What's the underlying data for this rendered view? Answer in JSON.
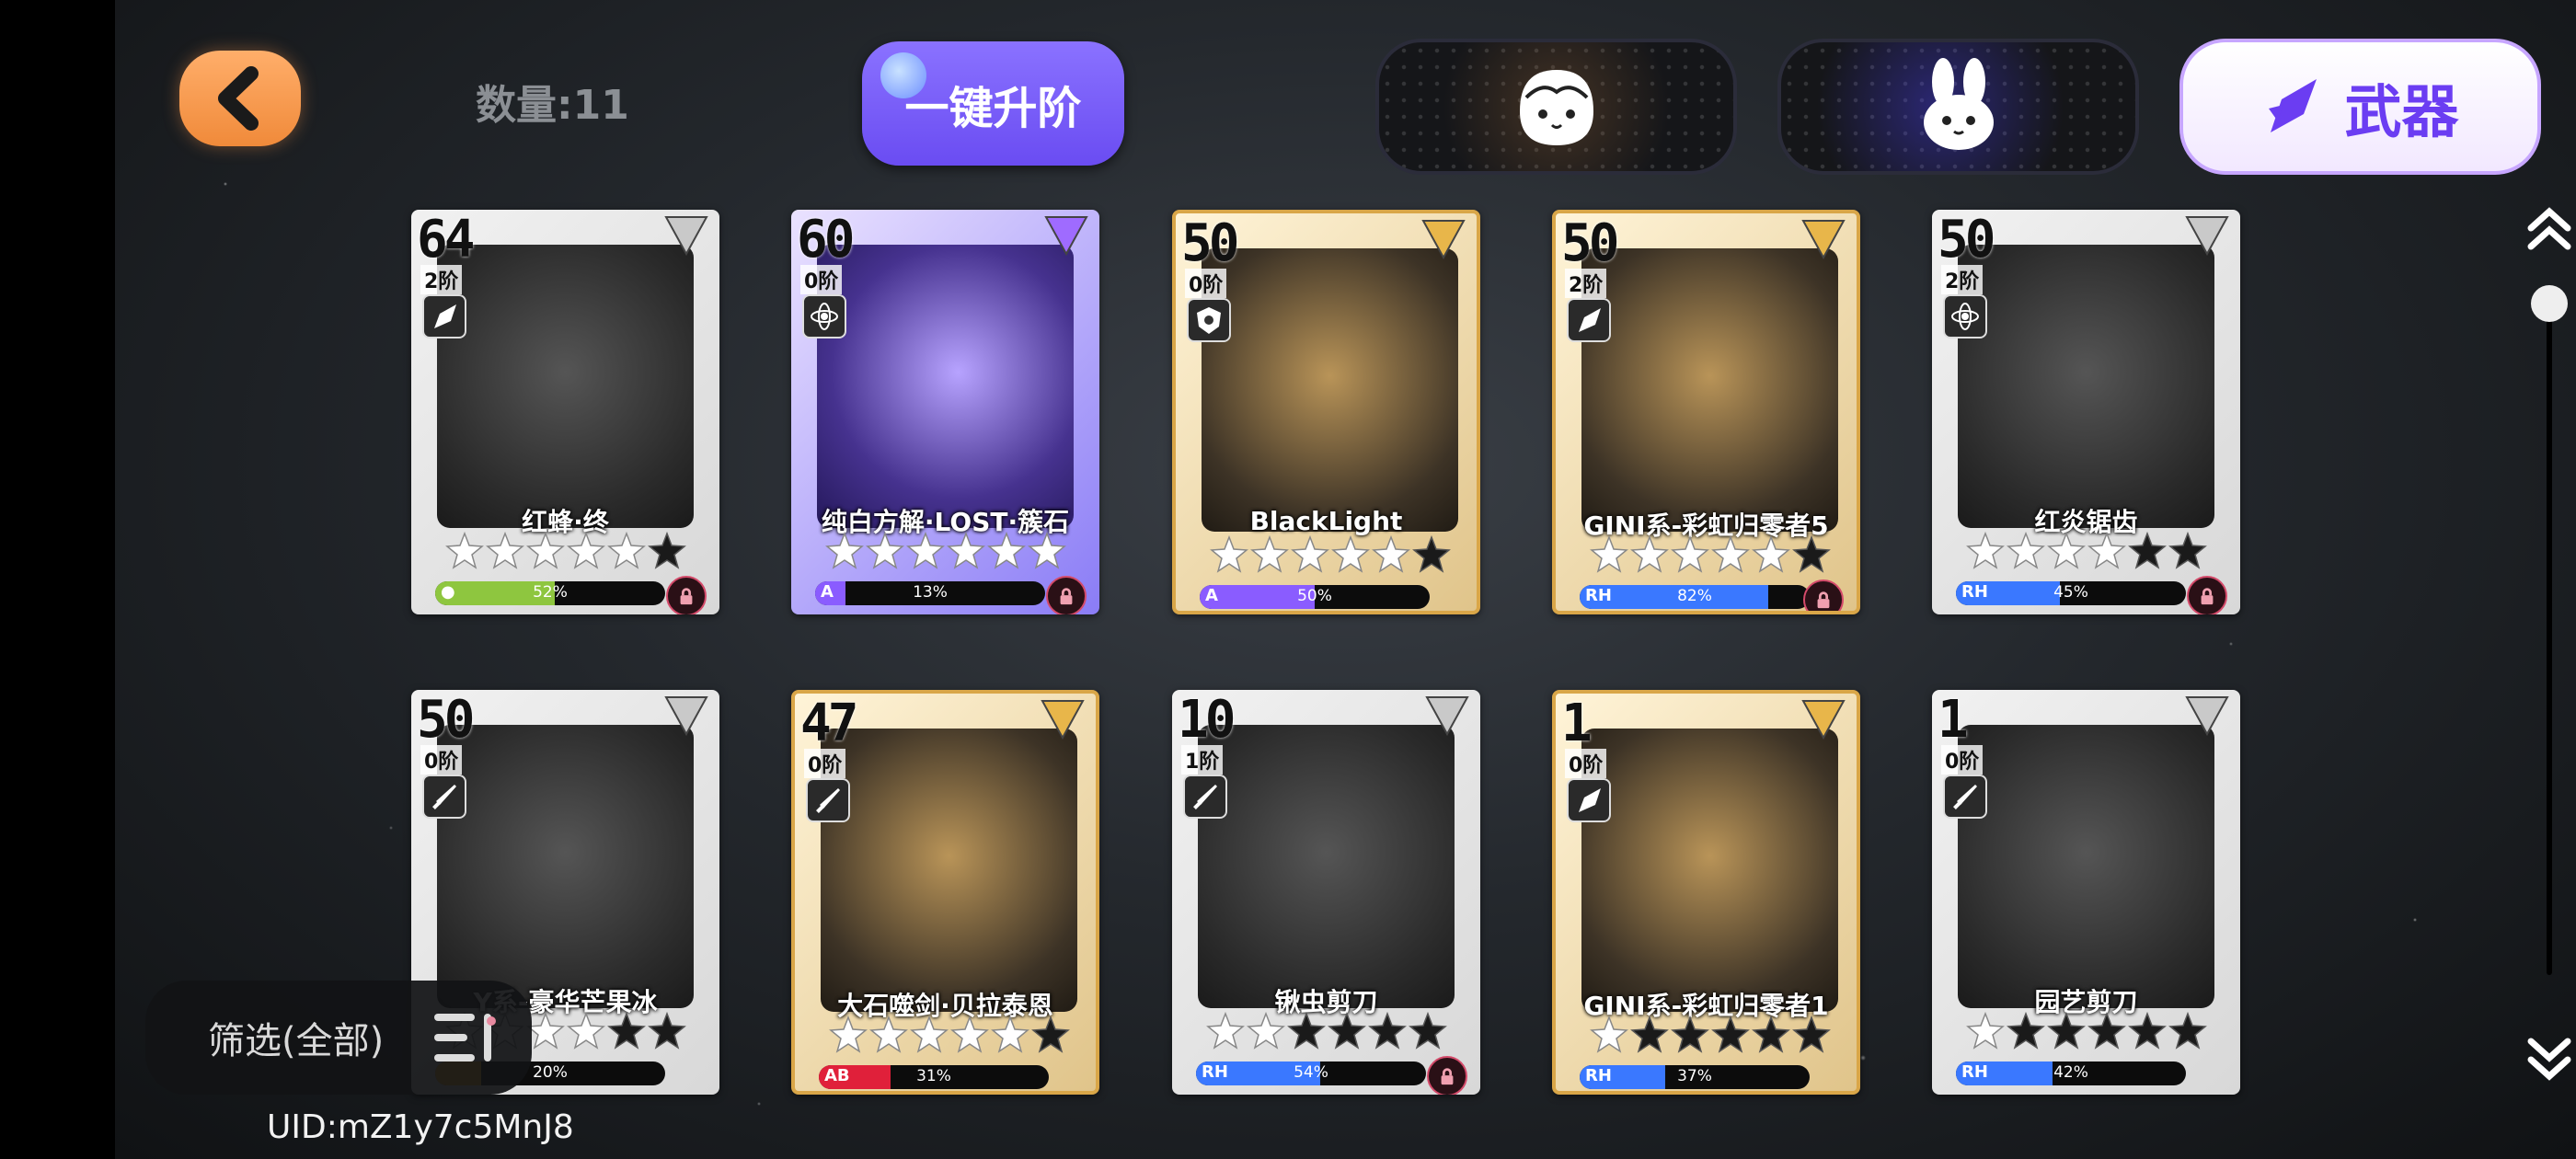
{
  "header": {
    "count_label": "数量:11",
    "upgrade_label": "一键升阶",
    "tabs": [
      {
        "name": "character-face",
        "label": ""
      },
      {
        "name": "bunny",
        "label": ""
      },
      {
        "name": "weapon",
        "label": "武器",
        "active": true
      }
    ]
  },
  "cards": [
    {
      "level": "64",
      "stage": "2阶",
      "name": "红蜂·终",
      "stars": 6,
      "stars_filled": 5,
      "bar_tag": "●",
      "percent": "52%",
      "progress": 0.52,
      "bar_color": "#8ec63f",
      "locked": true,
      "style": "silver",
      "type_icon": "rocket-icon"
    },
    {
      "level": "60",
      "stage": "0阶",
      "name": "纯白方解·LOST·簇石",
      "stars": 6,
      "stars_filled": 6,
      "bar_tag": "A",
      "percent": "13%",
      "progress": 0.13,
      "bar_color": "#8a5cff",
      "locked": true,
      "style": "special",
      "type_icon": "atom-icon"
    },
    {
      "level": "50",
      "stage": "0阶",
      "name": "BlackLight",
      "stars": 6,
      "stars_filled": 5,
      "bar_tag": "A",
      "percent": "50%",
      "progress": 0.5,
      "bar_color": "#8a5cff",
      "locked": false,
      "style": "gold",
      "type_icon": "shield-icon"
    },
    {
      "level": "50",
      "stage": "2阶",
      "name": "GINI系-彩虹归零者5",
      "stars": 6,
      "stars_filled": 5,
      "bar_tag": "RH",
      "percent": "82%",
      "progress": 0.82,
      "bar_color": "#3a78ff",
      "locked": true,
      "style": "gold",
      "type_icon": "rocket-icon"
    },
    {
      "level": "50",
      "stage": "2阶",
      "name": "红炎锯齿",
      "stars": 6,
      "stars_filled": 4,
      "bar_tag": "RH",
      "percent": "45%",
      "progress": 0.45,
      "bar_color": "#3a78ff",
      "locked": true,
      "style": "silver",
      "type_icon": "atom-icon"
    },
    {
      "level": "50",
      "stage": "0阶",
      "name": "Y系-豪华芒果冰",
      "stars": 6,
      "stars_filled": 4,
      "bar_tag": "",
      "percent": "20%",
      "progress": 0.2,
      "bar_color": "#ffb020",
      "locked": false,
      "style": "silver",
      "type_icon": "sword-icon"
    },
    {
      "level": "47",
      "stage": "0阶",
      "name": "大石噬剑·贝拉泰恩",
      "stars": 6,
      "stars_filled": 5,
      "bar_tag": "AB",
      "percent": "31%",
      "progress": 0.31,
      "bar_color": "#e0203a",
      "locked": false,
      "style": "gold",
      "type_icon": "sword-icon"
    },
    {
      "level": "10",
      "stage": "1阶",
      "name": "锹虫剪刀",
      "stars": 6,
      "stars_filled": 2,
      "bar_tag": "RH",
      "percent": "54%",
      "progress": 0.54,
      "bar_color": "#3a78ff",
      "locked": true,
      "style": "silver",
      "type_icon": "sword-icon"
    },
    {
      "level": "1",
      "stage": "0阶",
      "name": "GINI系-彩虹归零者1",
      "stars": 6,
      "stars_filled": 1,
      "bar_tag": "RH",
      "percent": "37%",
      "progress": 0.37,
      "bar_color": "#3a78ff",
      "locked": false,
      "style": "gold",
      "type_icon": "rocket-icon"
    },
    {
      "level": "1",
      "stage": "0阶",
      "name": "园艺剪刀",
      "stars": 6,
      "stars_filled": 1,
      "bar_tag": "RH",
      "percent": "42%",
      "progress": 0.42,
      "bar_color": "#3a78ff",
      "locked": false,
      "style": "silver",
      "type_icon": "sword-icon"
    }
  ],
  "filter": {
    "label": "筛选(全部)"
  },
  "footer": {
    "uid": "UID:mZ1y7c5MnJ8"
  },
  "colors": {
    "accent": "#6a4cf2",
    "back": "#f08a3a",
    "lock": "#d44a6a"
  }
}
